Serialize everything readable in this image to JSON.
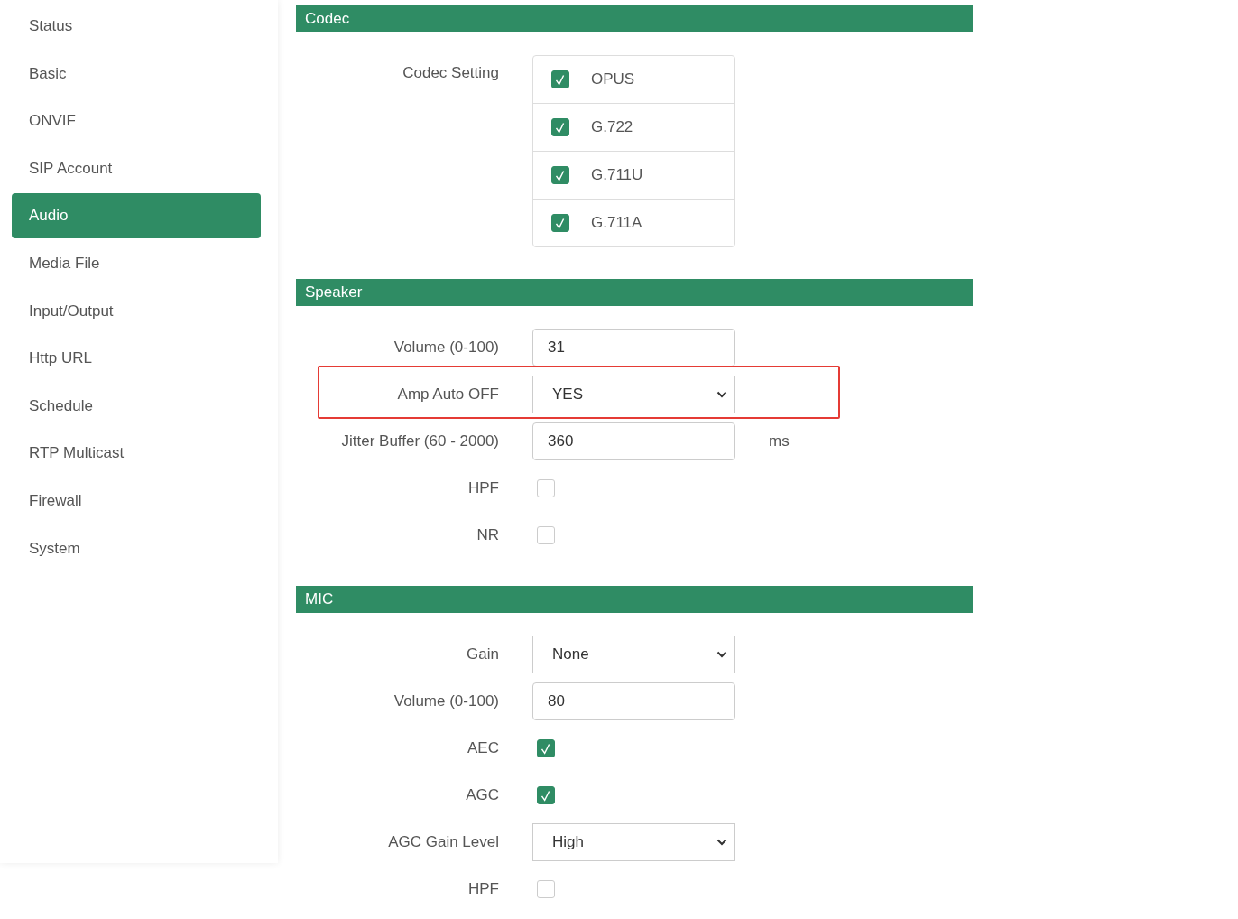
{
  "sidebar": {
    "items": [
      {
        "label": "Status",
        "selected": false
      },
      {
        "label": "Basic",
        "selected": false
      },
      {
        "label": "ONVIF",
        "selected": false
      },
      {
        "label": "SIP Account",
        "selected": false
      },
      {
        "label": "Audio",
        "selected": true
      },
      {
        "label": "Media File",
        "selected": false
      },
      {
        "label": "Input/Output",
        "selected": false
      },
      {
        "label": "Http URL",
        "selected": false
      },
      {
        "label": "Schedule",
        "selected": false
      },
      {
        "label": "RTP Multicast",
        "selected": false
      },
      {
        "label": "Firewall",
        "selected": false
      },
      {
        "label": "System",
        "selected": false
      }
    ]
  },
  "sections": [
    {
      "title": "Codec",
      "rows": [
        {
          "kind": "checklist",
          "label": "Codec Setting",
          "highlighted": false,
          "options": [
            {
              "label": "OPUS",
              "checked": true
            },
            {
              "label": "G.722",
              "checked": true
            },
            {
              "label": "G.711U",
              "checked": true
            },
            {
              "label": "G.711A",
              "checked": true
            }
          ]
        }
      ]
    },
    {
      "title": "Speaker",
      "rows": [
        {
          "kind": "input",
          "label": "Volume (0-100)",
          "value": "31",
          "highlighted": false
        },
        {
          "kind": "select",
          "label": "Amp Auto OFF",
          "value": "YES",
          "highlighted": true
        },
        {
          "kind": "input",
          "label": "Jitter Buffer (60 - 2000)",
          "value": "360",
          "unit": "ms",
          "highlighted": false
        },
        {
          "kind": "checkbox",
          "label": "HPF",
          "checked": false,
          "highlighted": false
        },
        {
          "kind": "checkbox",
          "label": "NR",
          "checked": false,
          "highlighted": false
        }
      ]
    },
    {
      "title": "MIC",
      "rows": [
        {
          "kind": "select",
          "label": "Gain",
          "value": "None",
          "highlighted": false
        },
        {
          "kind": "input",
          "label": "Volume (0-100)",
          "value": "80",
          "highlighted": false
        },
        {
          "kind": "checkbox",
          "label": "AEC",
          "checked": true,
          "highlighted": false
        },
        {
          "kind": "checkbox",
          "label": "AGC",
          "checked": true,
          "highlighted": false
        },
        {
          "kind": "select",
          "label": "AGC Gain Level",
          "value": "High",
          "highlighted": false
        },
        {
          "kind": "checkbox",
          "label": "HPF",
          "checked": false,
          "highlighted": false
        }
      ]
    }
  ]
}
